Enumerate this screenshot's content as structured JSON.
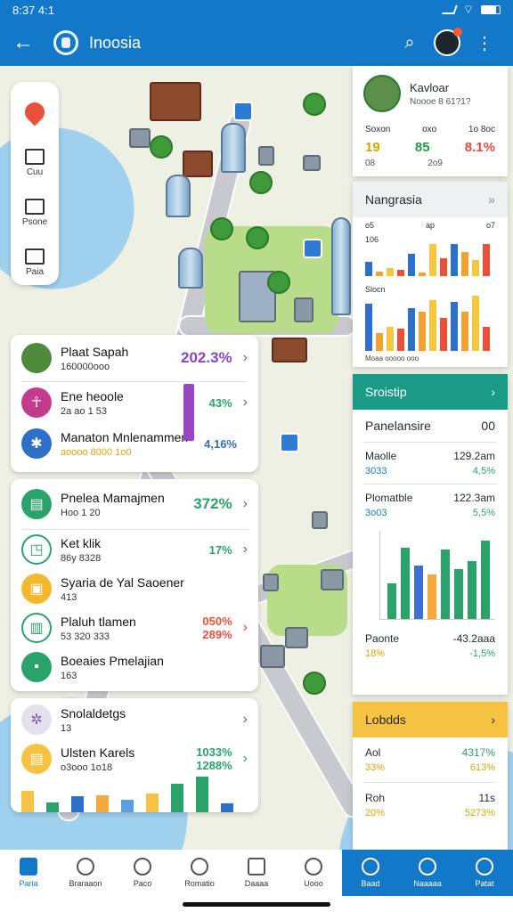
{
  "status": {
    "time": "8:37 4:1"
  },
  "appbar": {
    "title": "Inoosia"
  },
  "toolbar": {
    "items": [
      {
        "label": ""
      },
      {
        "label": "Cuu"
      },
      {
        "label": "Psone"
      },
      {
        "label": "Paia"
      }
    ]
  },
  "profile": {
    "name": "Kavloar",
    "sub": "Noooe 8 61?1?",
    "stats": [
      {
        "label": "Soxon",
        "value": "19",
        "color": "#d4a800"
      },
      {
        "label": "oxo",
        "value": "85",
        "color": "#2a9a4a"
      },
      {
        "label": "1o 8oc",
        "value": "8.1%",
        "color": "#e34b3b"
      }
    ],
    "stat_subs": [
      "08",
      "2o9",
      ""
    ]
  },
  "chart1": {
    "title": "Nangrasia",
    "labels": [
      "o5",
      "ap",
      "o7"
    ],
    "row_labels": [
      "106",
      "Slocn"
    ],
    "bottom": "Moaa ooooo ooo"
  },
  "chart_data": [
    {
      "type": "bar",
      "title": "Nangrasia",
      "series_colors": [
        "#2d6fc9",
        "#f2a234",
        "#f5c640",
        "#e8503a"
      ],
      "row1": [
        18,
        6,
        10,
        8,
        28,
        5,
        40,
        22,
        40,
        30,
        20,
        40
      ],
      "row2": [
        60,
        22,
        30,
        28,
        54,
        50,
        64,
        42,
        62,
        50,
        70,
        30
      ]
    },
    {
      "type": "bar",
      "title": "Sroistip",
      "colors": [
        "#2aa36b",
        "#2aa36b",
        "#3b6fd4",
        "#f4a93a",
        "#2aa36b",
        "#2aa36b"
      ],
      "values": [
        40,
        80,
        60,
        50,
        78,
        56,
        65,
        88
      ]
    }
  ],
  "left_card1": {
    "rows": [
      {
        "title": "Plaat Sapah",
        "sub": "160000ooo",
        "value": "202.3%",
        "color": "#8a45c9"
      },
      {
        "title": "Ene heoole",
        "sub": "2a ao 1 53",
        "value": "43%",
        "color": "#2aa36b"
      },
      {
        "title": "Manaton Mnlenammen",
        "sub": "aoooo 8000 1o0",
        "value": "4,16%",
        "color": "#2d6fc9"
      }
    ]
  },
  "left_card2": {
    "rows": [
      {
        "title": "Pnelea Mamajmen",
        "sub": "Hoo 1 20",
        "value": "372%",
        "color": "#2aa36b"
      },
      {
        "title": "Ket klik",
        "sub": "86y 8328",
        "value": "17%",
        "color": "#2aa36b"
      },
      {
        "title": "Syaria de Yal Saoener",
        "sub": "413",
        "value": "",
        "color": "#e8503a"
      },
      {
        "title": "Plaluh tlamen",
        "sub": "53 320 333",
        "value": "050%",
        "color": "#e8503a"
      },
      {
        "title": "Boeaies Pmelajian",
        "sub": "163",
        "value": "",
        "color": "#2aa36b"
      }
    ],
    "extra_value": "289%"
  },
  "left_card3": {
    "rows": [
      {
        "title": "Snolaldetgs",
        "sub": "13"
      },
      {
        "title": "Ulsten Karels",
        "sub": "o3ooo 1o18",
        "value": "1033%",
        "value2": "1288%",
        "color": "#2aa36b"
      }
    ]
  },
  "right_card2": {
    "title": "Sroistip",
    "head2": "Panelansire",
    "head2_value": "00",
    "rows": [
      {
        "title": "Maolle",
        "sub": "3033",
        "v1": "129.2am",
        "v2": "4,5%",
        "color": "#2aa36b"
      },
      {
        "title": "Plomatble",
        "sub": "3o03",
        "v1": "122.3am",
        "v2": "5,5%",
        "color": "#2aa36b"
      }
    ],
    "foot_title": "Paonte",
    "foot_value": "-43.2aaa",
    "foot_sub": "18%",
    "foot_sub2": "-1,5%"
  },
  "right_card3": {
    "title": "Lobdds",
    "rows": [
      {
        "title": "Aol",
        "sub": "33%",
        "v1": "4317%",
        "v2": "613%"
      },
      {
        "title": "Roh",
        "sub": "20%",
        "v1": "11s",
        "v2": "5273%"
      }
    ]
  },
  "bottomnav": {
    "items": [
      "Paria",
      "Braraaon",
      "Paco",
      "Romatio",
      "Daaaa",
      "Uooo",
      "Baad",
      "Naaaaa",
      "Patat"
    ]
  }
}
